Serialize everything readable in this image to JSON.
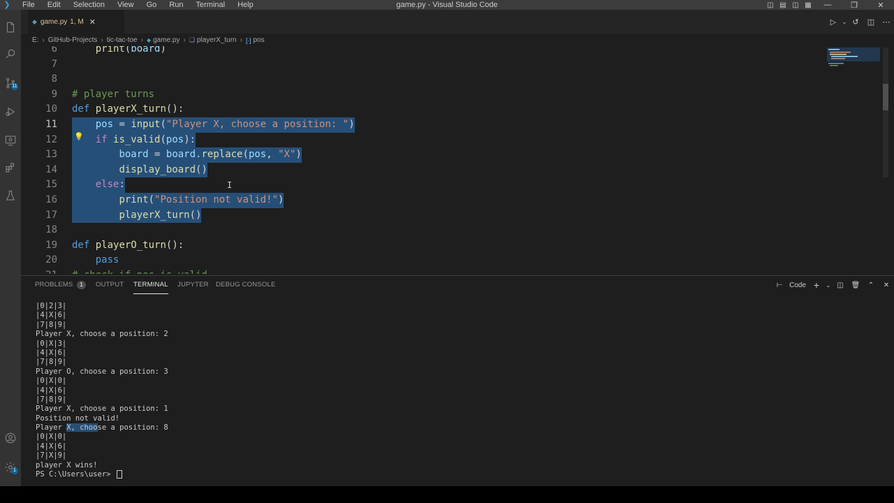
{
  "window": {
    "title": "game.py - Visual Studio Code",
    "menu": [
      "File",
      "Edit",
      "Selection",
      "View",
      "Go",
      "Run",
      "Terminal",
      "Help"
    ]
  },
  "activity_bar": {
    "items": [
      {
        "icon": "files-icon"
      },
      {
        "icon": "search-icon"
      },
      {
        "icon": "source-control-icon",
        "badge": "11"
      },
      {
        "icon": "run-debug-icon"
      },
      {
        "icon": "remote-explorer-icon"
      },
      {
        "icon": "extensions-icon"
      },
      {
        "icon": "testing-icon"
      }
    ],
    "bottom": [
      {
        "icon": "account-icon"
      },
      {
        "icon": "manage-gear-icon",
        "badge": "1"
      }
    ]
  },
  "tabs": [
    {
      "label": "game.py",
      "status": "1, M",
      "active": true
    }
  ],
  "breadcrumb": [
    "E:",
    "GitHub-Projects",
    "tic-tac-toe",
    "game.py",
    "playerX_turn",
    "pos"
  ],
  "editor": {
    "visible_lines": [
      {
        "n": "6",
        "text": "    print(board)"
      },
      {
        "n": "7",
        "text": ""
      },
      {
        "n": "8",
        "text": ""
      },
      {
        "n": "9",
        "text": "# player turns"
      },
      {
        "n": "10",
        "text": "def playerX_turn():"
      },
      {
        "n": "11",
        "text": "    pos = input(\"Player X, choose a position: \")"
      },
      {
        "n": "12",
        "text": "    if is_valid(pos):"
      },
      {
        "n": "13",
        "text": "        board = board.replace(pos, \"X\")"
      },
      {
        "n": "14",
        "text": "        display_board()"
      },
      {
        "n": "15",
        "text": "    else:"
      },
      {
        "n": "16",
        "text": "        print(\"Position not valid!\")"
      },
      {
        "n": "17",
        "text": "        playerX_turn()"
      },
      {
        "n": "18",
        "text": ""
      },
      {
        "n": "19",
        "text": "def playerO_turn():"
      },
      {
        "n": "20",
        "text": "    pass"
      },
      {
        "n": "21",
        "text": "# check if pos is valid"
      }
    ],
    "current_line": "11",
    "selection_lines": [
      "11",
      "12",
      "13",
      "14",
      "15",
      "16",
      "17"
    ]
  },
  "panel": {
    "tabs": [
      "PROBLEMS",
      "OUTPUT",
      "TERMINAL",
      "JUPYTER",
      "DEBUG CONSOLE"
    ],
    "problems_count": "1",
    "active_tab": "TERMINAL",
    "terminal_profile": "Code",
    "terminal_lines": [
      "|0|2|3|",
      "|4|X|6|",
      "|7|8|9|",
      "Player X, choose a position: 2",
      "|0|X|3|",
      "|4|X|6|",
      "|7|8|9|",
      "Player O, choose a position: 3",
      "|0|X|0|",
      "|4|X|6|",
      "|7|8|9|",
      "Player X, choose a position: 1",
      "Position not valid!",
      "Player X, choose a position: 8",
      "|0|X|0|",
      "|4|X|6|",
      "|7|X|9|",
      "player X wins!",
      "PS C:\\Users\\user> "
    ]
  },
  "colors": {
    "accent": "#007acc",
    "selection": "#264f78",
    "keyword": "#569cd6",
    "function": "#dcdcaa",
    "string": "#ce9178",
    "comment": "#6a9955"
  }
}
